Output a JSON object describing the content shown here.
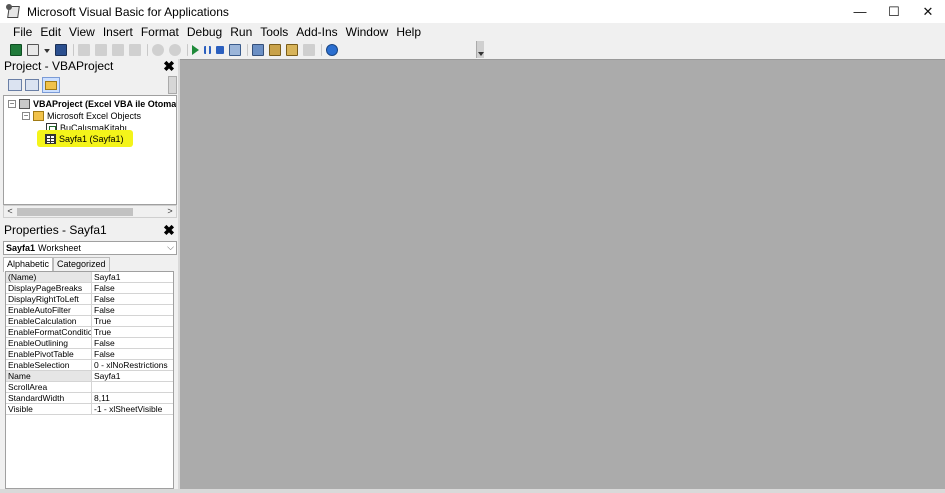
{
  "window": {
    "title": "Microsoft Visual Basic for Applications",
    "minimize": "—",
    "maximize": "☐",
    "close": "✕"
  },
  "menu": [
    "File",
    "Edit",
    "View",
    "Insert",
    "Format",
    "Debug",
    "Run",
    "Tools",
    "Add-Ins",
    "Window",
    "Help"
  ],
  "project_pane": {
    "title": "Project - VBAProject",
    "close": "✖",
    "tree": {
      "project": "VBAProject (Excel VBA ile Otomatik S",
      "folder": "Microsoft Excel Objects",
      "workbook": "BuÇalışmaKitabı",
      "sheet": "Sayfa1 (Sayfa1)"
    },
    "scroll_left": "<",
    "scroll_right": ">"
  },
  "properties_pane": {
    "title": "Properties - Sayfa1",
    "close": "✖",
    "object_name": "Sayfa1",
    "object_type": "Worksheet",
    "dropdown": "⌵",
    "tabs": [
      "Alphabetic",
      "Categorized"
    ],
    "rows": [
      {
        "name": "(Name)",
        "value": "Sayfa1"
      },
      {
        "name": "DisplayPageBreaks",
        "value": "False"
      },
      {
        "name": "DisplayRightToLeft",
        "value": "False"
      },
      {
        "name": "EnableAutoFilter",
        "value": "False"
      },
      {
        "name": "EnableCalculation",
        "value": "True"
      },
      {
        "name": "EnableFormatConditions(",
        "value": "True"
      },
      {
        "name": "EnableOutlining",
        "value": "False"
      },
      {
        "name": "EnablePivotTable",
        "value": "False"
      },
      {
        "name": "EnableSelection",
        "value": "0 - xlNoRestrictions"
      },
      {
        "name": "Name",
        "value": "Sayfa1"
      },
      {
        "name": "ScrollArea",
        "value": ""
      },
      {
        "name": "StandardWidth",
        "value": "8,11"
      },
      {
        "name": "Visible",
        "value": "-1 - xlSheetVisible"
      }
    ]
  },
  "colors": {
    "highlight": "#f4f41a",
    "mdi_background": "#ababab"
  }
}
